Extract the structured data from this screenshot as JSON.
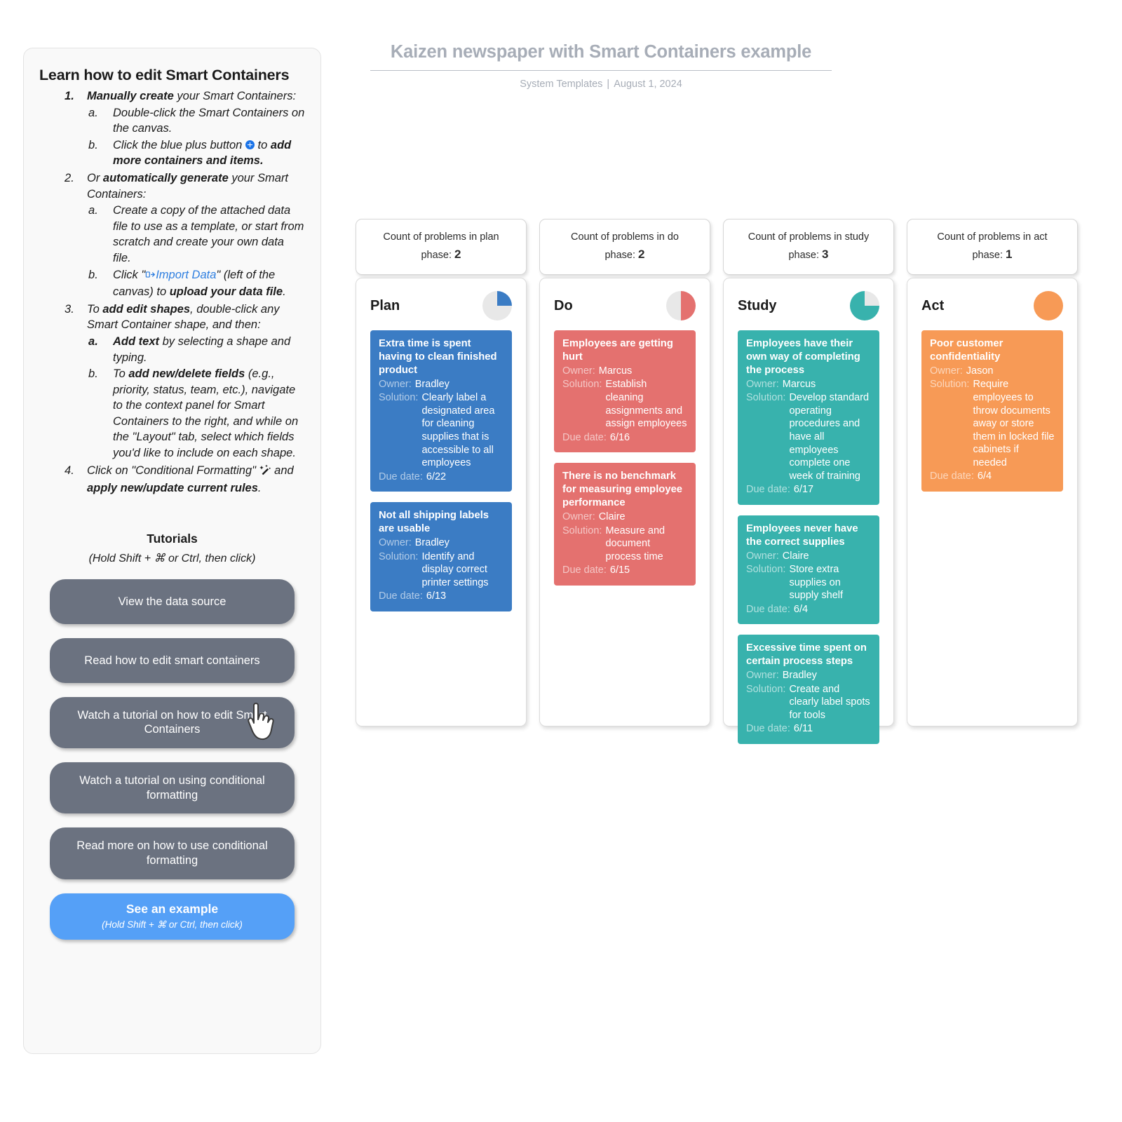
{
  "help": {
    "title": "Learn how to edit Smart Containers",
    "steps": [
      {
        "num": "1.",
        "bold_lead": "Manually create",
        "rest": " your Smart Containers:",
        "sub": [
          {
            "label": "a.",
            "text": "Double-click the Smart Containers on the canvas."
          },
          {
            "label": "b.",
            "text_pre": "Click the blue plus button ",
            "icon": "plus-icon",
            "text_mid": " to ",
            "bold_tail": "add more containers and items."
          }
        ]
      },
      {
        "num": "2.",
        "pre": "Or ",
        "bold_lead": "automatically generate",
        "rest": " your Smart Containers:",
        "sub": [
          {
            "label": "a.",
            "text": "Create a copy of the attached data file to use as a template, or start from scratch and create your own data file."
          },
          {
            "label": "b.",
            "text_pre": "Click \"",
            "link": "Import Data",
            "icon": "import-data-icon",
            "text_mid": "\" (left of the canvas) to ",
            "bold_tail": "upload your data file",
            "text_end": "."
          }
        ]
      },
      {
        "num": "3.",
        "pre": "To ",
        "bold_lead": "add edit shapes",
        "rest": ", double-click any Smart Container shape, and then:",
        "sub": [
          {
            "label": "a.",
            "bold_lead": "Add text",
            "text": " by selecting a shape and typing."
          },
          {
            "label": "b.",
            "pre": "To ",
            "bold_lead": "add new/delete fields",
            "text": " (e.g., priority, status, team, etc.), navigate to the context panel for Smart Containers to the right, and while on the \"Layout\" tab, select which fields you'd like to include on each shape."
          }
        ]
      },
      {
        "num": "4.",
        "pre": "Click on \"Conditional Formatting\" ",
        "icon": "magic-wand-icon",
        "text_mid": " and ",
        "bold_tail": "apply new/update current rules",
        "text_end": "."
      }
    ],
    "tutorials_heading": "Tutorials",
    "tutorials_subheading": "(Hold Shift + ⌘ or Ctrl, then click)",
    "buttons": [
      {
        "label": "View the data source"
      },
      {
        "label": "Read how to edit smart containers"
      },
      {
        "label": "Watch a tutorial on how to edit Smart Containers"
      },
      {
        "label": "Watch a tutorial on using conditional formatting"
      },
      {
        "label": "Read more on how to use conditional formatting"
      }
    ],
    "primary_button": {
      "label": "See an example",
      "sublabel": "(Hold Shift + ⌘ or Ctrl, then click)"
    }
  },
  "header": {
    "title": "Kaizen newspaper with Smart Containers example",
    "source": "System Templates",
    "separator": "|",
    "date": "August 1, 2024"
  },
  "counts": [
    {
      "label_pre": "Count of problems in plan phase: ",
      "value": "2"
    },
    {
      "label_pre": "Count of problems in do phase: ",
      "value": "2"
    },
    {
      "label_pre": "Count of problems in study phase: ",
      "value": "3"
    },
    {
      "label_pre": "Count of problems in act phase: ",
      "value": "1"
    }
  ],
  "labels": {
    "owner": "Owner:",
    "solution": "Solution:",
    "due_date": "Due date:"
  },
  "columns": [
    {
      "title": "Plan",
      "color": "#3b7cc4",
      "pie_percent": 25,
      "cards": [
        {
          "title": "Extra time is spent having to clean finished product",
          "owner": "Bradley",
          "solution": "Clearly label a designated area for cleaning supplies that is accessible to all employees",
          "due_date": "6/22"
        },
        {
          "title": "Not all shipping labels are usable",
          "owner": "Bradley",
          "solution": "Identify and display correct printer settings",
          "due_date": "6/13"
        }
      ]
    },
    {
      "title": "Do",
      "color": "#e4716f",
      "pie_percent": 50,
      "cards": [
        {
          "title": "Employees are getting hurt",
          "owner": "Marcus",
          "solution": "Establish cleaning assignments and assign employees",
          "due_date": "6/16"
        },
        {
          "title": "There is no benchmark for measuring employee performance",
          "owner": "Claire",
          "solution": "Measure and document process time",
          "due_date": "6/15"
        }
      ]
    },
    {
      "title": "Study",
      "color": "#38b2ad",
      "pie_percent": 75,
      "cards": [
        {
          "title": "Employees have their own way of completing the process",
          "owner": "Marcus",
          "solution": "Develop standard operating procedures and have all employees complete one week of training",
          "due_date": "6/17"
        },
        {
          "title": "Employees never have the correct supplies",
          "owner": "Claire",
          "solution": "Store extra supplies on supply shelf",
          "due_date": "6/4"
        },
        {
          "title": "Excessive time spent on certain process steps",
          "owner": "Bradley",
          "solution": "Create and clearly label spots for tools",
          "due_date": "6/11"
        }
      ]
    },
    {
      "title": "Act",
      "color": "#f79a56",
      "pie_percent": 100,
      "cards": [
        {
          "title": "Poor customer confidentiality",
          "owner": "Jason",
          "solution": "Require employees to throw documents away or store them in locked file cabinets if needed",
          "due_date": "6/4"
        }
      ]
    }
  ]
}
